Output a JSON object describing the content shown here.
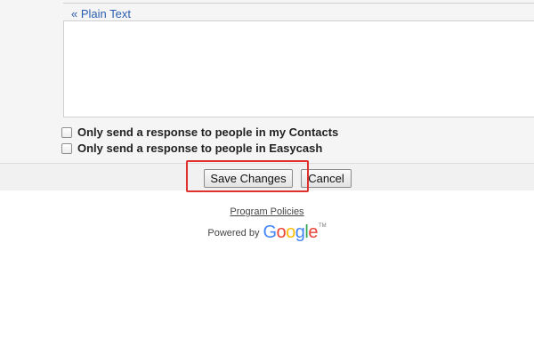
{
  "editor": {
    "plain_text_link": "« Plain Text",
    "message_value": ""
  },
  "options": [
    {
      "label": "Only send a response to people in my Contacts",
      "checked": false
    },
    {
      "label": "Only send a response to people in Easycash",
      "checked": false
    }
  ],
  "actions": {
    "save_label": "Save Changes",
    "cancel_label": "Cancel",
    "highlighted": "save_button"
  },
  "footer": {
    "program_policies": "Program Policies",
    "powered_by": "Powered by",
    "google_letters": [
      "G",
      "o",
      "o",
      "g",
      "l",
      "e"
    ],
    "google_colors": [
      "#4285F4",
      "#EA4335",
      "#FBBC05",
      "#4285F4",
      "#34A853",
      "#EA4335"
    ],
    "trademark": "TM"
  },
  "colors": {
    "link": "#2a5db0",
    "highlight": "#e0312f"
  }
}
